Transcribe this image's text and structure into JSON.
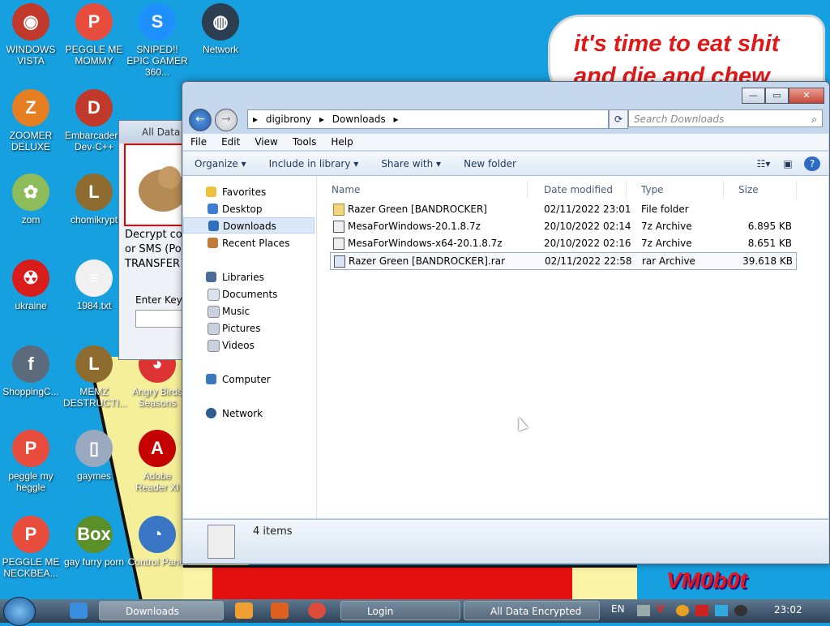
{
  "background": {
    "note_text": "it's time to eat shit and die and chew",
    "brand_text": "VM0b0t"
  },
  "desktop_icons": [
    {
      "label": "WINDOWS VISTA",
      "color": "#c0392b",
      "glyph": "◉"
    },
    {
      "label": "PEGGLE ME MOMMY",
      "color": "#e74c3c",
      "glyph": "P"
    },
    {
      "label": "SNIPED!! EPIC GAMER 360...",
      "color": "#1e90ff",
      "glyph": "S"
    },
    {
      "label": "Network",
      "color": "#2c3e50",
      "glyph": "◍"
    },
    {
      "label": "ZOOMER DELUXE",
      "color": "#e67e22",
      "glyph": "Z"
    },
    {
      "label": "Embarcadero Dev-C++",
      "color": "#c0392b",
      "glyph": "D"
    },
    {
      "label": "zom",
      "color": "#8fbc5a",
      "glyph": "✿"
    },
    {
      "label": "chomikrypt",
      "color": "#8e6b2e",
      "glyph": "L"
    },
    {
      "label": "ukraine",
      "color": "#d81b1b",
      "glyph": "☢"
    },
    {
      "label": "1984.txt",
      "color": "#f0f0f0",
      "glyph": "≡"
    },
    {
      "label": "ShoppingC...",
      "color": "#5b6b7b",
      "glyph": "f"
    },
    {
      "label": "MEMZ DESTRUCTI...",
      "color": "#8e6b2e",
      "glyph": "L"
    },
    {
      "label": "Angry Birds Seasons",
      "color": "#d33",
      "glyph": "◕"
    },
    {
      "label": "peggle my heggle",
      "color": "#e74c3c",
      "glyph": "P"
    },
    {
      "label": "gaymes",
      "color": "#9aa8c0",
      "glyph": "▯"
    },
    {
      "label": "Adobe Reader XI",
      "color": "#c40000",
      "glyph": "A"
    },
    {
      "label": "PEGGLE ME NECKBEA...",
      "color": "#e74c3c",
      "glyph": "P"
    },
    {
      "label": "gay furry porn",
      "color": "#5a8f2a",
      "glyph": "Box"
    },
    {
      "label": "Control Panel",
      "color": "#3a76c6",
      "glyph": "◔"
    }
  ],
  "dialog": {
    "title": "All Data E",
    "text_lines": [
      "Decrypt cos",
      "or SMS (Po",
      "TRANSFER t"
    ],
    "key_label": "Enter Key"
  },
  "explorer": {
    "breadcrumb": [
      "digibrony",
      "Downloads"
    ],
    "search_placeholder": "Search Downloads",
    "menu": [
      "File",
      "Edit",
      "View",
      "Tools",
      "Help"
    ],
    "commands": [
      "Organize",
      "Include in library",
      "Share with",
      "New folder"
    ],
    "nav": {
      "favorites": "Favorites",
      "favorites_items": [
        "Desktop",
        "Downloads",
        "Recent Places"
      ],
      "libraries": "Libraries",
      "libraries_items": [
        "Documents",
        "Music",
        "Pictures",
        "Videos"
      ],
      "computer": "Computer",
      "network": "Network"
    },
    "columns": [
      "Name",
      "Date modified",
      "Type",
      "Size"
    ],
    "files": [
      {
        "name": "Razer Green [BANDROCKER]",
        "date": "02/11/2022 23:01",
        "type": "File folder",
        "size": ""
      },
      {
        "name": "MesaForWindows-20.1.8.7z",
        "date": "20/10/2022 02:14",
        "type": "7z Archive",
        "size": "6.895 KB"
      },
      {
        "name": "MesaForWindows-x64-20.1.8.7z",
        "date": "20/10/2022 02:16",
        "type": "7z Archive",
        "size": "8.651 KB"
      },
      {
        "name": "Razer Green [BANDROCKER].rar",
        "date": "02/11/2022 22:58",
        "type": "rar Archive",
        "size": "39.618 KB"
      }
    ],
    "status": "4 items"
  },
  "taskbar": {
    "tasks": [
      "Downloads",
      "Login",
      "All Data Encrypted"
    ],
    "lang": "EN",
    "clock": "23:02"
  }
}
